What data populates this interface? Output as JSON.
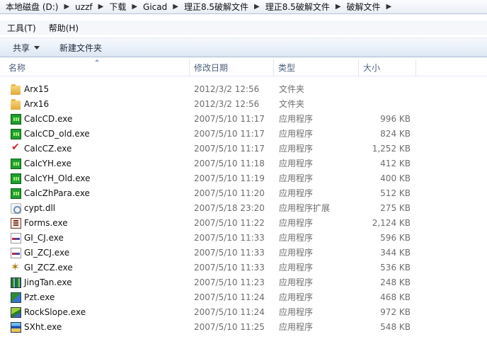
{
  "breadcrumb": [
    "本地磁盘 (D:)",
    "uzzf",
    "下载",
    "Gicad",
    "理正8.5破解文件",
    "理正8.5破解文件",
    "破解文件"
  ],
  "menu": [
    "工具(T)",
    "帮助(H)"
  ],
  "toolbar": {
    "share_label": "共享",
    "new_folder_label": "新建文件夹"
  },
  "columns": {
    "name": "名称",
    "date": "修改日期",
    "type": "类型",
    "size": "大小"
  },
  "files": [
    {
      "name": "Arx15",
      "date": "2012/3/2 12:56",
      "type": "文件夹",
      "size": "",
      "icon": "folder-icon"
    },
    {
      "name": "Arx16",
      "date": "2012/3/2 12:56",
      "type": "文件夹",
      "size": "",
      "icon": "folder-icon"
    },
    {
      "name": "CalcCD.exe",
      "date": "2007/5/10 11:17",
      "type": "应用程序",
      "size": "996 KB",
      "icon": "green-app-icon"
    },
    {
      "name": "CalcCD_old.exe",
      "date": "2007/5/10 11:17",
      "type": "应用程序",
      "size": "824 KB",
      "icon": "green-app-icon"
    },
    {
      "name": "CalcCZ.exe",
      "date": "2007/5/10 11:17",
      "type": "应用程序",
      "size": "1,252 KB",
      "icon": "check-app-icon"
    },
    {
      "name": "CalcYH.exe",
      "date": "2007/5/10 11:18",
      "type": "应用程序",
      "size": "412 KB",
      "icon": "green-app-icon"
    },
    {
      "name": "CalcYH_Old.exe",
      "date": "2007/5/10 11:19",
      "type": "应用程序",
      "size": "400 KB",
      "icon": "green-app-icon"
    },
    {
      "name": "CalcZhPara.exe",
      "date": "2007/5/10 11:20",
      "type": "应用程序",
      "size": "512 KB",
      "icon": "green-app-icon"
    },
    {
      "name": "cypt.dll",
      "date": "2007/5/18 23:20",
      "type": "应用程序扩展",
      "size": "275 KB",
      "icon": "dll-icon"
    },
    {
      "name": "Forms.exe",
      "date": "2007/5/10 11:22",
      "type": "应用程序",
      "size": "2,124 KB",
      "icon": "forms-app-icon"
    },
    {
      "name": "GI_CJ.exe",
      "date": "2007/5/10 11:33",
      "type": "应用程序",
      "size": "596 KB",
      "icon": "gi-app-icon"
    },
    {
      "name": "GI_ZCJ.exe",
      "date": "2007/5/10 11:33",
      "type": "应用程序",
      "size": "344 KB",
      "icon": "gi-app-icon"
    },
    {
      "name": "GI_ZCZ.exe",
      "date": "2007/5/10 11:33",
      "type": "应用程序",
      "size": "536 KB",
      "icon": "gizcz-app-icon"
    },
    {
      "name": "JingTan.exe",
      "date": "2007/5/10 11:23",
      "type": "应用程序",
      "size": "248 KB",
      "icon": "jingtan-app-icon"
    },
    {
      "name": "Pzt.exe",
      "date": "2007/5/10 11:24",
      "type": "应用程序",
      "size": "468 KB",
      "icon": "pzt-app-icon"
    },
    {
      "name": "RockSlope.exe",
      "date": "2007/5/10 11:24",
      "type": "应用程序",
      "size": "972 KB",
      "icon": "rockslope-app-icon"
    },
    {
      "name": "SXht.exe",
      "date": "2007/5/10 11:25",
      "type": "应用程序",
      "size": "548 KB",
      "icon": "sxht-app-icon"
    }
  ]
}
